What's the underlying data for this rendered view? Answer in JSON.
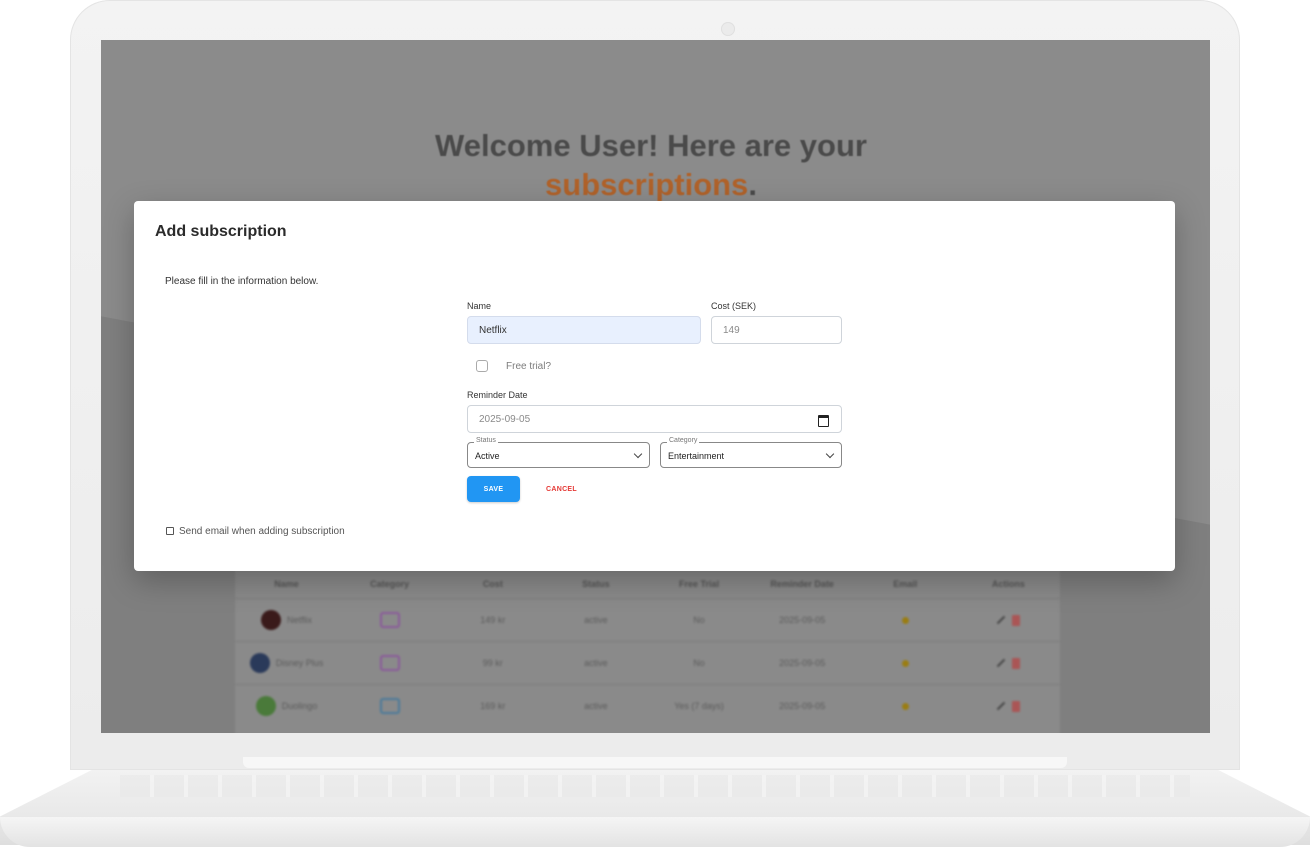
{
  "background": {
    "welcome_line1": "Welcome User! Here are your",
    "welcome_accent": "subscriptions",
    "welcome_end": ".",
    "table_headers": [
      "Name",
      "Category",
      "Cost",
      "Status",
      "Free Trial",
      "Reminder Date",
      "Email",
      "Actions"
    ],
    "rows": [
      {
        "name": "Netflix",
        "cost": "149 kr",
        "status": "active",
        "trial": "No",
        "date": "2025-09-05"
      },
      {
        "name": "Disney Plus",
        "cost": "99 kr",
        "status": "active",
        "trial": "No",
        "date": "2025-09-05"
      },
      {
        "name": "Duolingo",
        "cost": "169 kr",
        "status": "active",
        "trial": "Yes (7 days)",
        "date": "2025-09-05"
      }
    ]
  },
  "modal": {
    "title": "Add subscription",
    "subtitle": "Please fill in the information below.",
    "name_label": "Name",
    "name_value": "Netflix",
    "cost_label": "Cost (SEK)",
    "cost_value": "149",
    "free_trial_label": "Free trial?",
    "reminder_label": "Reminder Date",
    "reminder_value": "2025-09-05",
    "status_label": "Status",
    "status_value": "Active",
    "category_label": "Category",
    "category_value": "Entertainment",
    "save_label": "SAVE",
    "cancel_label": "CANCEL",
    "email_label": "Send email when adding subscription"
  },
  "colors": {
    "primary": "#2196f3",
    "danger": "#e53935",
    "accent": "#e67e22"
  }
}
